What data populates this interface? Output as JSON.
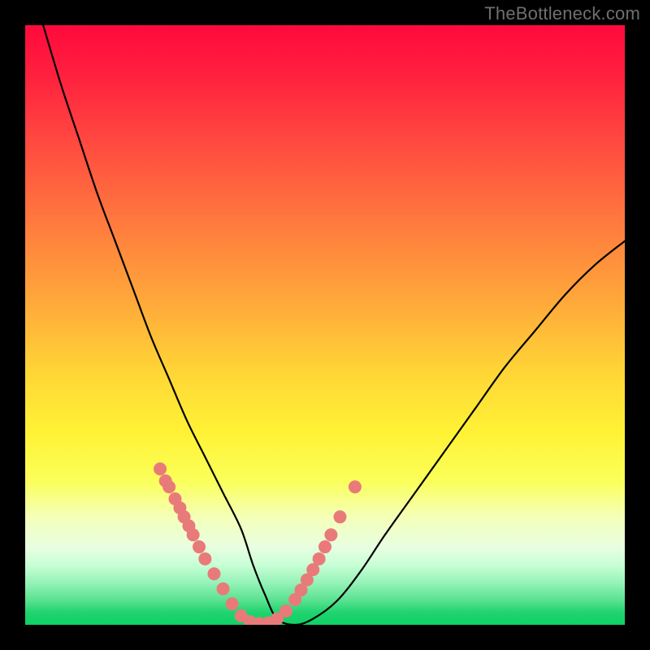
{
  "watermark": "TheBottleneck.com",
  "colors": {
    "frame": "#000000",
    "curve": "#000000",
    "dot_fill": "#e97a7a",
    "dot_stroke": "#d86a6a",
    "gradient_top": "#ff0a3c",
    "gradient_bottom": "#0fd166"
  },
  "chart_data": {
    "type": "line",
    "title": "",
    "xlabel": "",
    "ylabel": "",
    "xlim": [
      0,
      100
    ],
    "ylim": [
      0,
      100
    ],
    "grid": false,
    "legend": false,
    "annotations": [],
    "series": [
      {
        "name": "bottleneck-curve",
        "x": [
          3,
          6,
          9,
          12,
          15,
          18,
          21,
          24,
          27,
          30,
          33,
          36,
          38,
          40,
          42,
          45,
          48,
          52,
          56,
          60,
          65,
          70,
          75,
          80,
          85,
          90,
          95,
          100
        ],
        "y": [
          100,
          90,
          81,
          72,
          64,
          56,
          48,
          41,
          34,
          28,
          22,
          16,
          10,
          5,
          1,
          0,
          1,
          4,
          9,
          15,
          22,
          29,
          36,
          43,
          49,
          55,
          60,
          64
        ]
      }
    ],
    "salmon_dots": {
      "comment": "coral/pink sample markers near the valley of the curve",
      "points": [
        {
          "x": 22.5,
          "y": 26
        },
        {
          "x": 23.4,
          "y": 24
        },
        {
          "x": 24.0,
          "y": 23
        },
        {
          "x": 25.0,
          "y": 21
        },
        {
          "x": 25.8,
          "y": 19.5
        },
        {
          "x": 26.5,
          "y": 18
        },
        {
          "x": 27.3,
          "y": 16.5
        },
        {
          "x": 28.0,
          "y": 15
        },
        {
          "x": 29.0,
          "y": 13
        },
        {
          "x": 30.0,
          "y": 11
        },
        {
          "x": 31.5,
          "y": 8.5
        },
        {
          "x": 33.0,
          "y": 6
        },
        {
          "x": 34.5,
          "y": 3.5
        },
        {
          "x": 36.0,
          "y": 1.5
        },
        {
          "x": 37.5,
          "y": 0.5
        },
        {
          "x": 39.0,
          "y": 0.2
        },
        {
          "x": 40.5,
          "y": 0.3
        },
        {
          "x": 42.0,
          "y": 1.0
        },
        {
          "x": 43.5,
          "y": 2.3
        },
        {
          "x": 45.0,
          "y": 4.2
        },
        {
          "x": 46.0,
          "y": 5.8
        },
        {
          "x": 47.0,
          "y": 7.5
        },
        {
          "x": 48.0,
          "y": 9.2
        },
        {
          "x": 49.0,
          "y": 11
        },
        {
          "x": 50.0,
          "y": 13
        },
        {
          "x": 51.0,
          "y": 15
        },
        {
          "x": 52.5,
          "y": 18
        },
        {
          "x": 55.0,
          "y": 23
        }
      ]
    }
  }
}
